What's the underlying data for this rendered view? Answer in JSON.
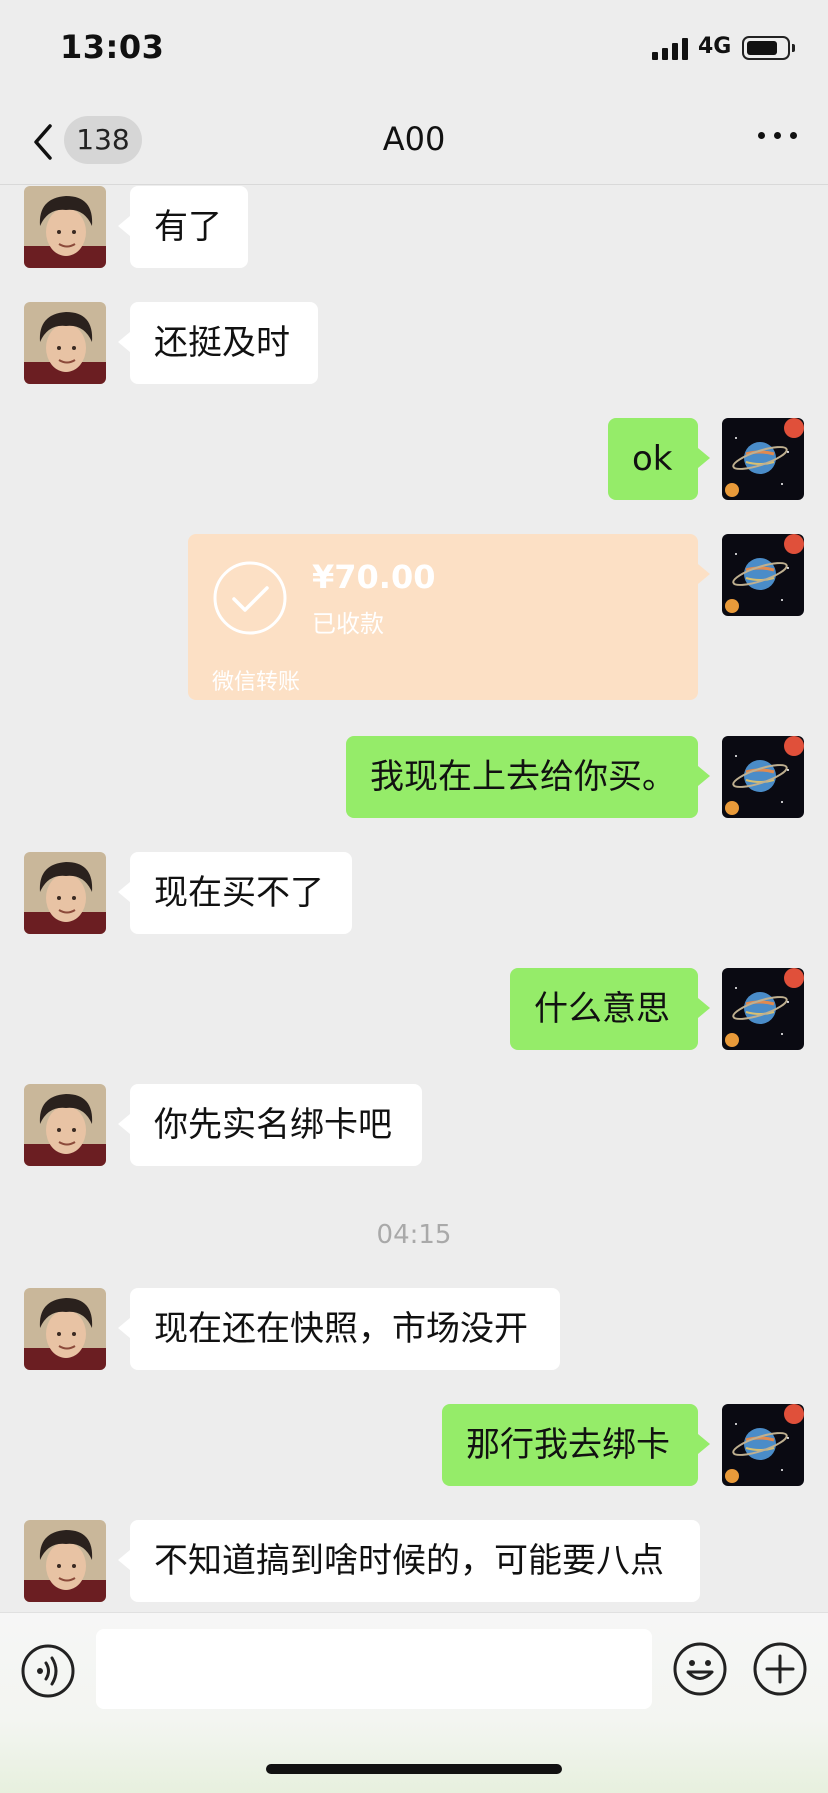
{
  "status_bar": {
    "time": "13:03",
    "network": "4G",
    "battery_percent": 75
  },
  "nav": {
    "back_badge": "138",
    "title": "A00",
    "more_icon": "more-icon"
  },
  "messages": [
    {
      "side": "left",
      "text": "有了"
    },
    {
      "side": "left",
      "text": "还挺及时"
    },
    {
      "side": "right",
      "text": "ok"
    },
    {
      "side": "right",
      "type": "transfer",
      "amount": "¥70.00",
      "status": "已收款",
      "label": "微信转账"
    },
    {
      "side": "right",
      "text": "我现在上去给你买。"
    },
    {
      "side": "left",
      "text": "现在买不了"
    },
    {
      "side": "right",
      "text": "什么意思"
    },
    {
      "side": "left",
      "text": "你先实名绑卡吧"
    },
    {
      "type": "timestamp",
      "text": "04:15"
    },
    {
      "side": "left",
      "text": "现在还在快照，市场没开"
    },
    {
      "side": "right",
      "text": "那行我去绑卡"
    },
    {
      "side": "left",
      "text": "不知道搞到啥时候的，可能要八点"
    }
  ],
  "input_bar": {
    "placeholder": "",
    "value": ""
  },
  "colors": {
    "background": "#EDEDED",
    "sent_bubble": "#95EC69",
    "received_bubble": "#FFFFFF",
    "transfer_card": "#FCE0C5"
  }
}
